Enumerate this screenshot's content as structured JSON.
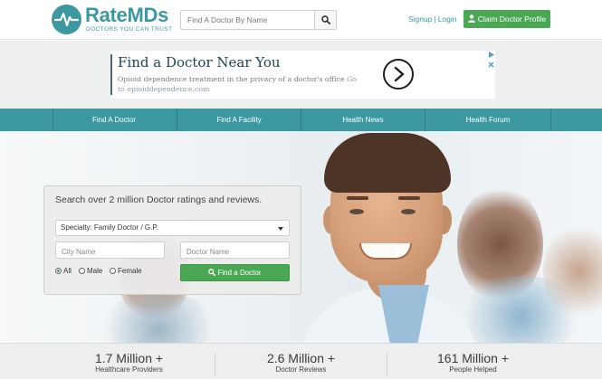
{
  "header": {
    "logo_name": "RateMDs",
    "logo_tagline": "DOCTORS YOU CAN TRUST",
    "search_placeholder": "Find A Doctor By Name",
    "signup_label": "Signup",
    "separator": "|",
    "login_label": "Login",
    "claim_label": "Claim Doctor Profile"
  },
  "ad": {
    "title": "Find a Doctor Near You",
    "body": "Opioid dependence treatment in the privacy of a doctor's office",
    "link_text": "Go to opioiddependence.com"
  },
  "nav": {
    "items": [
      {
        "label": "Find A Doctor"
      },
      {
        "label": "Find A Facility"
      },
      {
        "label": "Health News"
      },
      {
        "label": "Health Forum"
      }
    ]
  },
  "search_panel": {
    "title": "Search over 2 million Doctor ratings and reviews.",
    "specialty_value": "Specialty: Family Doctor / G.P.",
    "city_placeholder": "City Name",
    "doctor_placeholder": "Doctor Name",
    "gender_options": [
      {
        "label": "All",
        "selected": true
      },
      {
        "label": "Male",
        "selected": false
      },
      {
        "label": "Female",
        "selected": false
      }
    ],
    "find_label": "Find a Doctor"
  },
  "stats": [
    {
      "number": "1.7 Million +",
      "label": "Healthcare Providers"
    },
    {
      "number": "2.6 Million +",
      "label": "Doctor Reviews"
    },
    {
      "number": "161 Million +",
      "label": "People Helped"
    }
  ],
  "colors": {
    "brand_teal": "#3b98a0",
    "action_green": "#4aa854",
    "nav_bg": "#3b98a0",
    "ad_title": "#1f3f53"
  },
  "icons": {
    "logo": "heartbeat-icon",
    "search": "search-icon",
    "claim": "user-icon",
    "ad_next": "chevron-right-icon"
  }
}
